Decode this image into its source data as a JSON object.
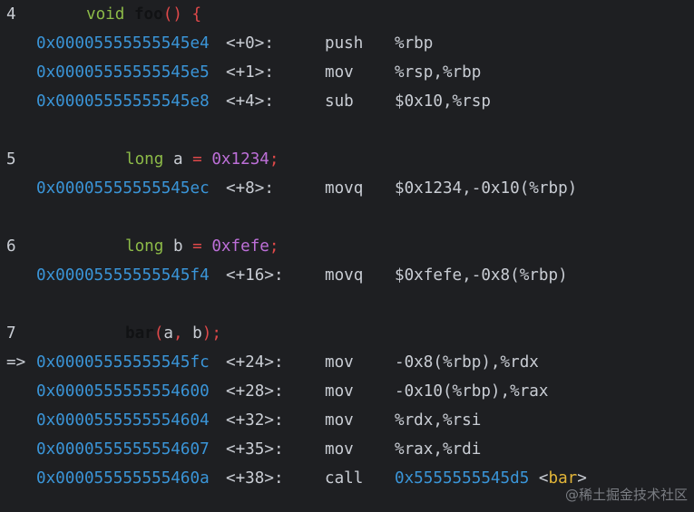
{
  "source_lines": {
    "l4": {
      "num": "4",
      "kw": "void",
      "fn": "foo",
      "paren": "()",
      "brace": "{"
    },
    "l5": {
      "num": "5",
      "type": "long",
      "var": "a",
      "eq": "=",
      "val": "0x1234",
      "semi": ";"
    },
    "l6": {
      "num": "6",
      "type": "long",
      "var": "b",
      "eq": "=",
      "val": "0xfefe",
      "semi": ";"
    },
    "l7": {
      "num": "7",
      "fn": "bar",
      "open": "(",
      "arg1": "a",
      "comma": ",",
      "arg2": "b",
      "close": ")",
      "semi": ";"
    }
  },
  "current_marker": "=>",
  "instructions": [
    {
      "addr": "0x00005555555545e4",
      "offset": "<+0>:",
      "mnemonic": "push",
      "operands": "%rbp"
    },
    {
      "addr": "0x00005555555545e5",
      "offset": "<+1>:",
      "mnemonic": "mov",
      "operands": "%rsp,%rbp"
    },
    {
      "addr": "0x00005555555545e8",
      "offset": "<+4>:",
      "mnemonic": "sub",
      "operands": "$0x10,%rsp"
    },
    {
      "addr": "0x00005555555545ec",
      "offset": "<+8>:",
      "mnemonic": "movq",
      "operands": "$0x1234,-0x10(%rbp)"
    },
    {
      "addr": "0x00005555555545f4",
      "offset": "<+16>:",
      "mnemonic": "movq",
      "operands": "$0xfefe,-0x8(%rbp)"
    },
    {
      "addr": "0x00005555555545fc",
      "offset": "<+24>:",
      "mnemonic": "mov",
      "operands": "-0x8(%rbp),%rdx"
    },
    {
      "addr": "0x0000555555554600",
      "offset": "<+28>:",
      "mnemonic": "mov",
      "operands": "-0x10(%rbp),%rax"
    },
    {
      "addr": "0x0000555555554604",
      "offset": "<+32>:",
      "mnemonic": "mov",
      "operands": "%rdx,%rsi"
    },
    {
      "addr": "0x0000555555554607",
      "offset": "<+35>:",
      "mnemonic": "mov",
      "operands": "%rax,%rdi"
    },
    {
      "addr": "0x000055555555460a",
      "offset": "<+38>:",
      "mnemonic": "call",
      "operands_addr": "0x5555555545d5",
      "operands_open": "<",
      "operands_sym": "bar",
      "operands_close": ">"
    }
  ],
  "watermark": "@稀土掘金技术社区",
  "colors": {
    "background": "#1e1f22",
    "address": "#3a95d8",
    "keyword": "#8dbb48",
    "number": "#bd6fd8",
    "operator": "#e0494a",
    "symbol": "#e2b538",
    "text": "#c9cdd4"
  }
}
